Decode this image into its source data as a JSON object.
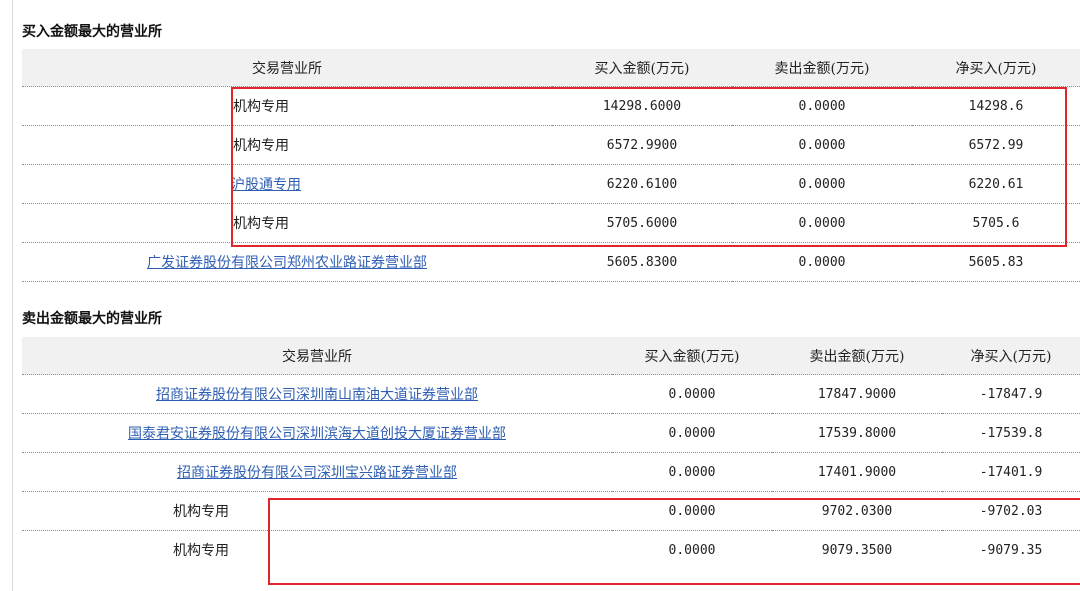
{
  "buy_section": {
    "title": "买入金额最大的营业所",
    "headers": [
      "交易营业所",
      "买入金额(万元)",
      "卖出金额(万元)",
      "净买入(万元)"
    ],
    "rows": [
      {
        "name": "机构专用",
        "is_link": false,
        "buy": "14298.6000",
        "sell": "0.0000",
        "net": "14298.6"
      },
      {
        "name": "机构专用",
        "is_link": false,
        "buy": "6572.9900",
        "sell": "0.0000",
        "net": "6572.99"
      },
      {
        "name": "沪股通专用",
        "is_link": true,
        "buy": "6220.6100",
        "sell": "0.0000",
        "net": "6220.61"
      },
      {
        "name": "机构专用",
        "is_link": false,
        "buy": "5705.6000",
        "sell": "0.0000",
        "net": "5705.6"
      },
      {
        "name": "广发证券股份有限公司郑州农业路证券营业部",
        "is_link": true,
        "buy": "5605.8300",
        "sell": "0.0000",
        "net": "5605.83"
      }
    ]
  },
  "sell_section": {
    "title": "卖出金额最大的营业所",
    "headers": [
      "交易营业所",
      "买入金额(万元)",
      "卖出金额(万元)",
      "净买入(万元)"
    ],
    "rows": [
      {
        "name": "招商证券股份有限公司深圳南山南油大道证券营业部",
        "is_link": true,
        "buy": "0.0000",
        "sell": "17847.9000",
        "net": "-17847.9"
      },
      {
        "name": "国泰君安证券股份有限公司深圳滨海大道创投大厦证券营业部",
        "is_link": true,
        "buy": "0.0000",
        "sell": "17539.8000",
        "net": "-17539.8"
      },
      {
        "name": "招商证券股份有限公司深圳宝兴路证券营业部",
        "is_link": true,
        "buy": "0.0000",
        "sell": "17401.9000",
        "net": "-17401.9"
      },
      {
        "name": "机构专用",
        "is_link": false,
        "buy": "0.0000",
        "sell": "9702.0300",
        "net": "-9702.03"
      },
      {
        "name": "机构专用",
        "is_link": false,
        "buy": "0.0000",
        "sell": "9079.3500",
        "net": "-9079.35"
      }
    ]
  },
  "highlight_color": "#e0262b",
  "link_color": "#2f5fb3"
}
